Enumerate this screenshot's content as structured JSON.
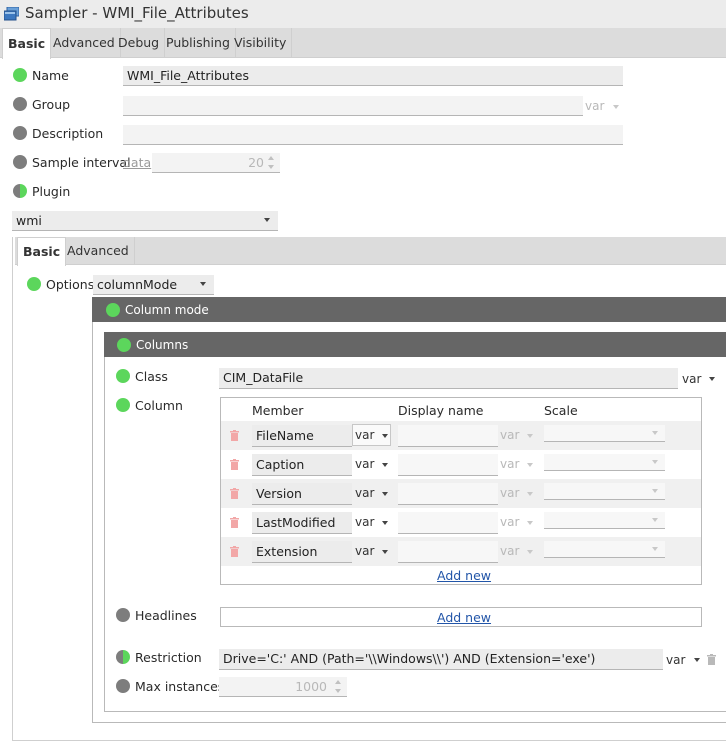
{
  "window": {
    "title": "Sampler - WMI_File_Attributes"
  },
  "tabs": [
    {
      "label": "Basic"
    },
    {
      "label": "Advanced"
    },
    {
      "label": "Debug"
    },
    {
      "label": "Publishing"
    },
    {
      "label": "Visibility"
    }
  ],
  "form": {
    "name": {
      "label": "Name",
      "value": "WMI_File_Attributes"
    },
    "group": {
      "label": "Group",
      "value": "",
      "var": "var"
    },
    "description": {
      "label": "Description",
      "value": ""
    },
    "sample_interval": {
      "label": "Sample interval",
      "unit": "data",
      "value": "20"
    },
    "plugin": {
      "label": "Plugin",
      "value": "wmi"
    }
  },
  "plugin_tabs": [
    {
      "label": "Basic"
    },
    {
      "label": "Advanced"
    }
  ],
  "options": {
    "label": "Options",
    "value": "columnMode"
  },
  "column_mode": {
    "title": "Column mode"
  },
  "columns_section": {
    "title": "Columns"
  },
  "class": {
    "label": "Class",
    "value": "CIM_DataFile",
    "var": "var"
  },
  "column": {
    "label": "Column",
    "headers": {
      "member": "Member",
      "display_name": "Display name",
      "scale": "Scale"
    },
    "rows": [
      {
        "member": "FileName",
        "var": "var",
        "display_name": "",
        "display_var": "var",
        "scale": ""
      },
      {
        "member": "Caption",
        "var": "var",
        "display_name": "",
        "display_var": "var",
        "scale": ""
      },
      {
        "member": "Version",
        "var": "var",
        "display_name": "",
        "display_var": "var",
        "scale": ""
      },
      {
        "member": "LastModified",
        "var": "var",
        "display_name": "",
        "display_var": "var",
        "scale": ""
      },
      {
        "member": "Extension",
        "var": "var",
        "display_name": "",
        "display_var": "var",
        "scale": ""
      }
    ],
    "add_new": "Add new"
  },
  "headlines": {
    "label": "Headlines",
    "add_new": "Add new"
  },
  "restriction": {
    "label": "Restriction",
    "value": "Drive='C:' AND (Path='\\\\Windows\\\\') AND (Extension='exe')",
    "var": "var"
  },
  "max_instances": {
    "label": "Max instances",
    "value": "1000"
  },
  "colors": {
    "accent_green": "#5cd65c",
    "status_gray": "#7d7d7d",
    "section_header": "#666666",
    "link": "#2255a8"
  }
}
